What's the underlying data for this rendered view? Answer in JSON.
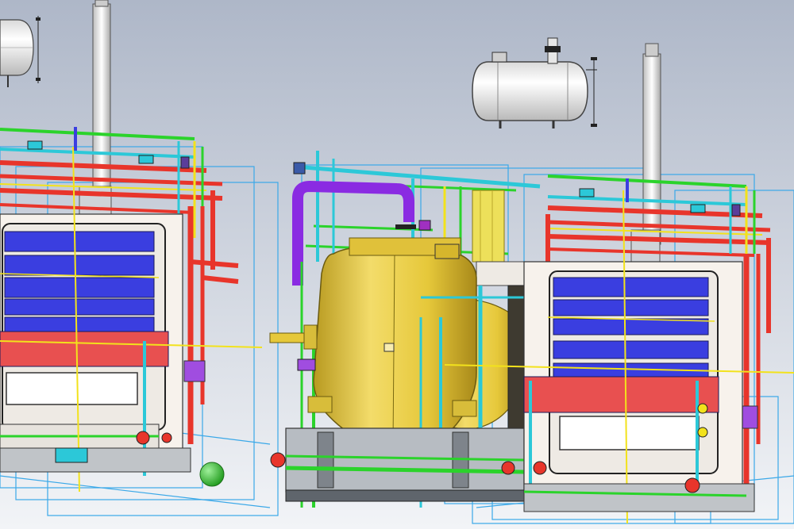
{
  "viewport": {
    "background_top": "#aeb7c8",
    "background_bottom": "#f2f4f7"
  },
  "colors": {
    "frame_red": "#e8352b",
    "pipe_green": "#2bd32b",
    "pipe_cyan": "#2cc8d8",
    "pipe_yellow": "#f2e21c",
    "pipe_purple": "#8a2be2",
    "panel_blue": "#3a3ee0",
    "panel_red": "#e85050",
    "vessel_yellow": "#e6c83a",
    "tank_white": "#f0f0f0",
    "steel_grey": "#8a8f96",
    "wire_blue": "#3aa8e8",
    "sphere_green": "#3ecf3a"
  },
  "components": [
    {
      "name": "left-boiler-unit"
    },
    {
      "name": "right-boiler-unit"
    },
    {
      "name": "central-pressure-vessel"
    },
    {
      "name": "upper-air-receiver-tank"
    },
    {
      "name": "left-air-receiver-tank"
    },
    {
      "name": "left-exhaust-stack"
    },
    {
      "name": "right-exhaust-stack"
    },
    {
      "name": "green-marker-sphere"
    }
  ]
}
